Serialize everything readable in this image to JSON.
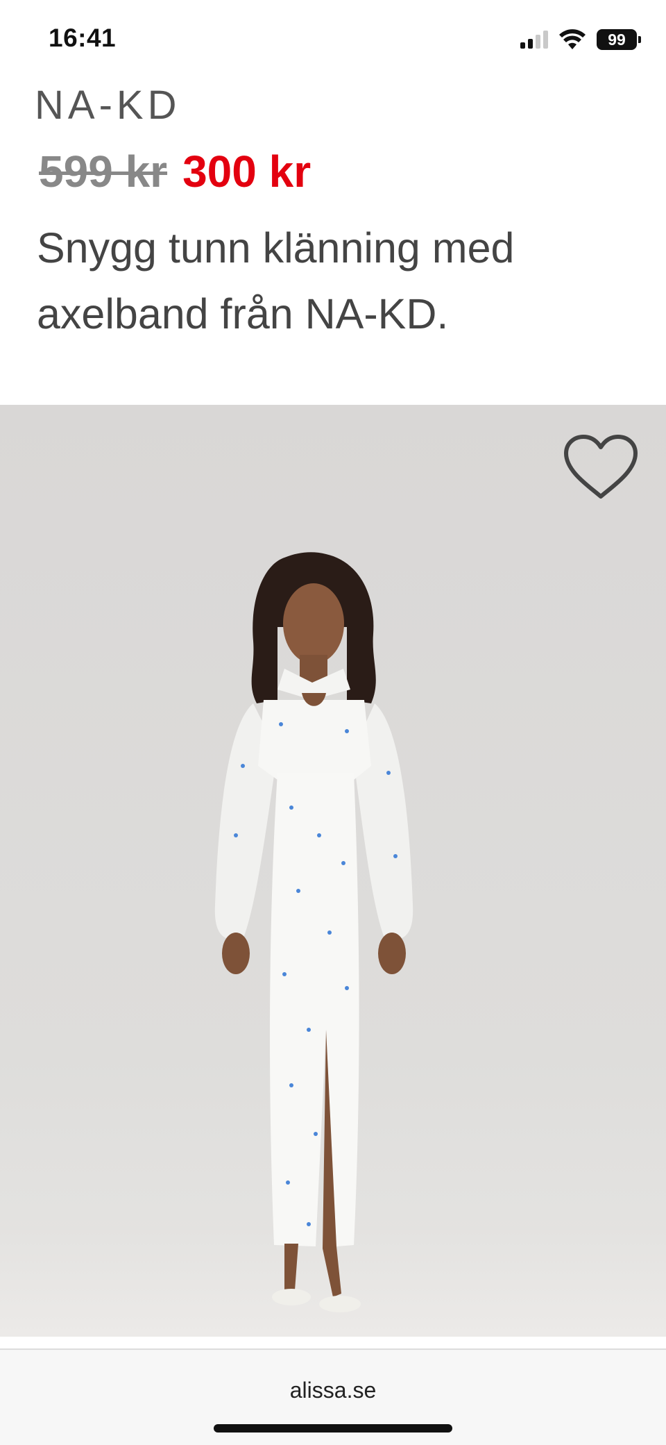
{
  "status_bar": {
    "time": "16:41",
    "battery": "99",
    "icons": [
      "cellular-signal-icon",
      "wifi-icon",
      "battery-icon"
    ]
  },
  "product": {
    "brand": "NA-KD",
    "price_original": "599 kr",
    "price_sale": "300 kr",
    "description": "Snygg tunn klänning med axelband från NA-KD.",
    "image_icon": "dress-photo",
    "favorite_icon": "heart-outline-icon"
  },
  "browser": {
    "url": "alissa.se"
  },
  "colors": {
    "sale_price": "#e3000f",
    "original_price": "#888888",
    "text": "#444444"
  }
}
